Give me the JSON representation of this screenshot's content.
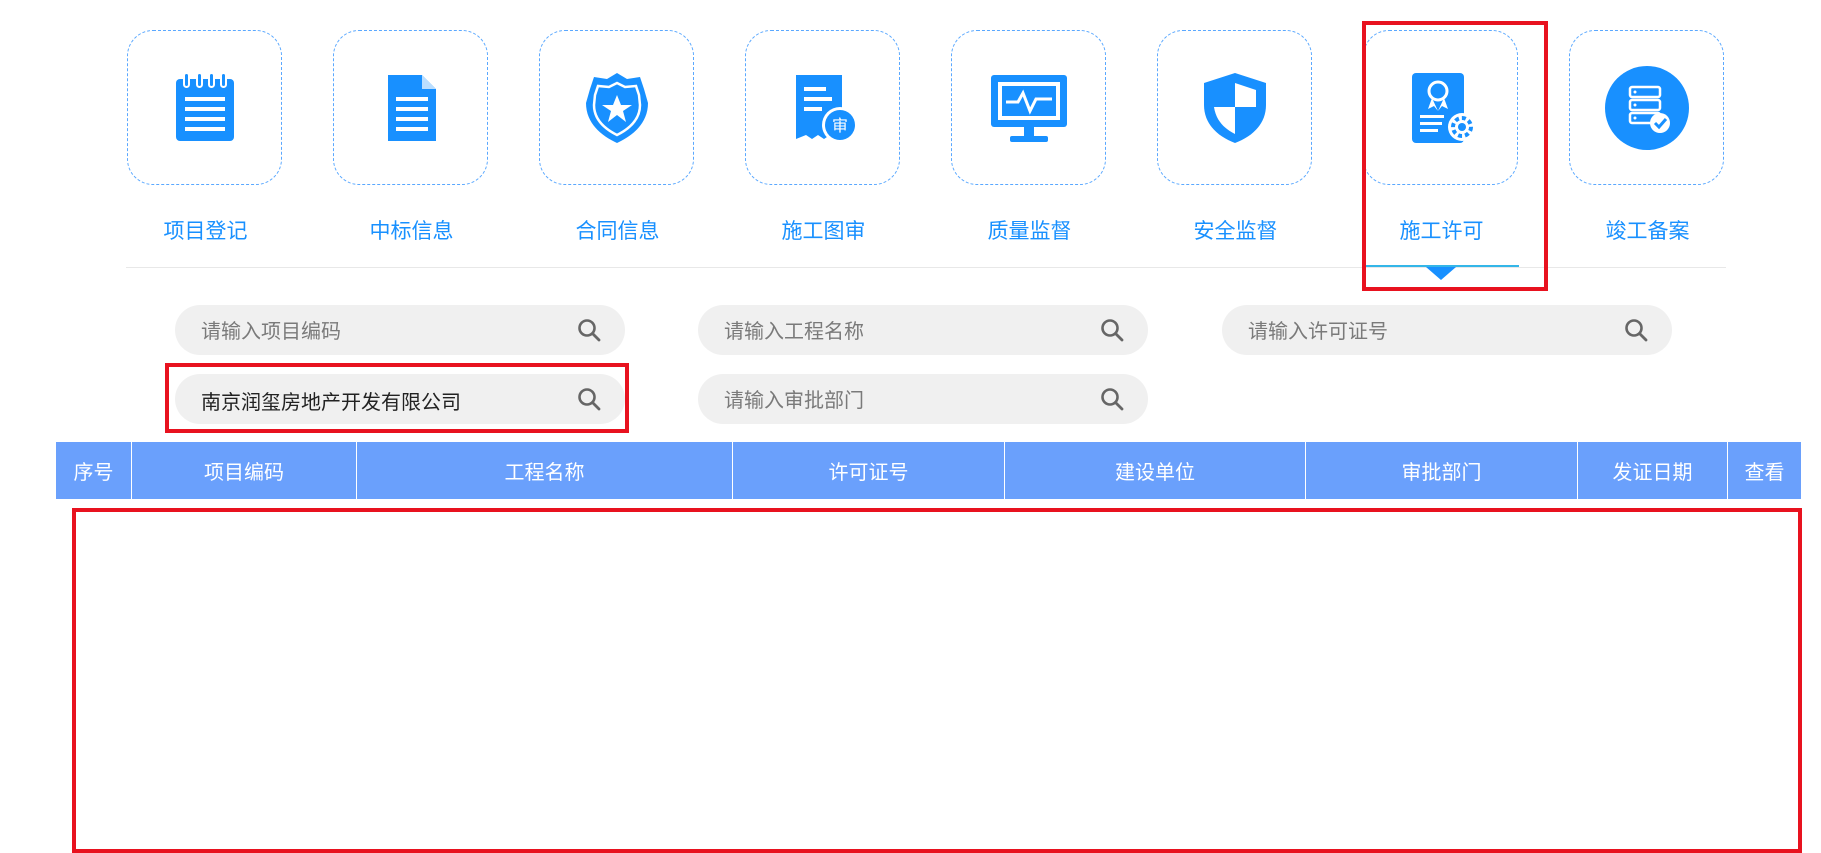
{
  "nav": {
    "items": [
      {
        "label": "项目登记",
        "icon": "notepad-icon"
      },
      {
        "label": "中标信息",
        "icon": "document-icon"
      },
      {
        "label": "合同信息",
        "icon": "badge-star-icon"
      },
      {
        "label": "施工图审",
        "icon": "receipt-review-icon"
      },
      {
        "label": "质量监督",
        "icon": "monitor-pulse-icon"
      },
      {
        "label": "安全监督",
        "icon": "shield-icon"
      },
      {
        "label": "施工许可",
        "icon": "certificate-gear-icon",
        "active": true
      },
      {
        "label": "竣工备案",
        "icon": "server-check-icon"
      }
    ],
    "accent_color": "#1890ff"
  },
  "search": {
    "project_code": {
      "placeholder": "请输入项目编码",
      "value": ""
    },
    "project_name": {
      "placeholder": "请输入工程名称",
      "value": ""
    },
    "permit_no": {
      "placeholder": "请输入许可证号",
      "value": ""
    },
    "builder": {
      "placeholder": "",
      "value": "南京润玺房地产开发有限公司"
    },
    "approval_dept": {
      "placeholder": "请输入审批部门",
      "value": ""
    }
  },
  "table": {
    "header_color": "#6aa0fc",
    "columns": [
      "序号",
      "项目编码",
      "工程名称",
      "许可证号",
      "建设单位",
      "审批部门",
      "发证日期",
      "查看"
    ],
    "rows": []
  },
  "highlight_color": "#e8121f"
}
